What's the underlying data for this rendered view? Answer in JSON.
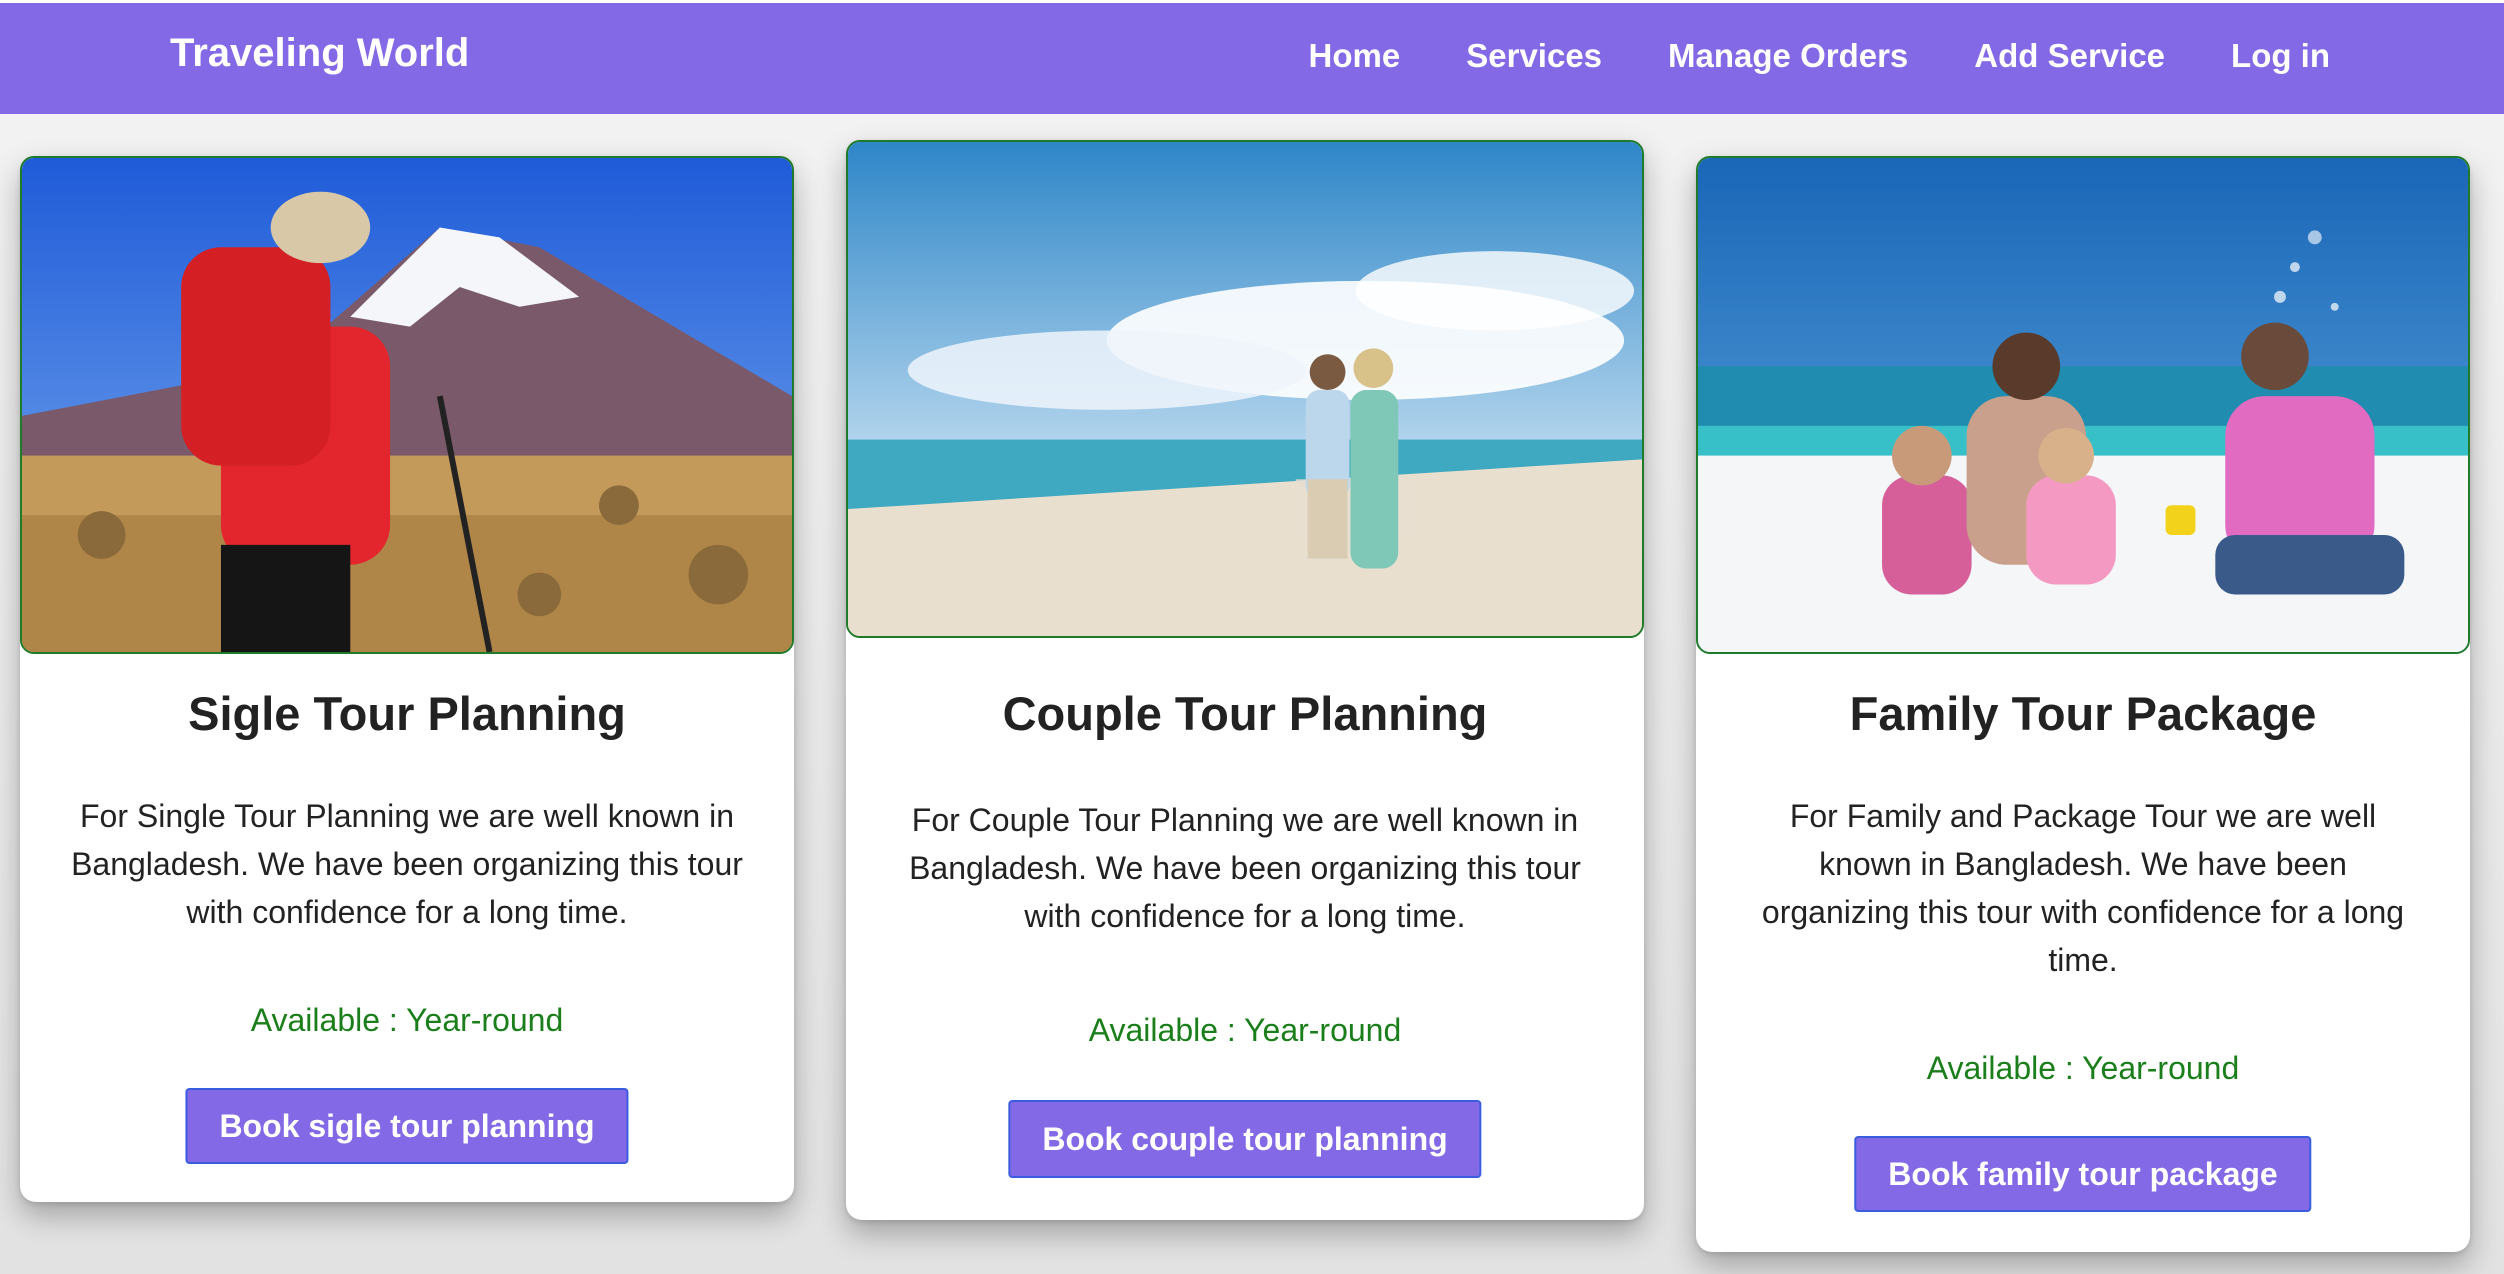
{
  "navbar": {
    "brand": "Traveling World",
    "links": [
      "Home",
      "Services",
      "Manage Orders",
      "Add Service",
      "Log in"
    ]
  },
  "cards": [
    {
      "image": "hiker-mountain-image",
      "title": "Sigle Tour Planning",
      "text_lines": [
        "For Single Tour Planning we are well known in",
        "Bangladesh. We have been organizing this tour",
        "with confidence for a long time."
      ],
      "availability": "Available : Year-round",
      "button": "Book sigle tour planning"
    },
    {
      "image": "couple-beach-image",
      "title": "Couple Tour Planning",
      "text_lines": [
        "For Couple Tour Planning we are well known in",
        "Bangladesh. We have been organizing this tour",
        "with confidence for a long time."
      ],
      "availability": "Available : Year-round",
      "button": "Book couple tour planning"
    },
    {
      "image": "family-beach-image",
      "title": "Family Tour Package",
      "text_lines": [
        "For Family and Package Tour we are well",
        "known in Bangladesh. We have been",
        "organizing this tour with confidence for a long",
        "time."
      ],
      "availability": "Available : Year-round",
      "button": "Book family tour package"
    }
  ],
  "colors": {
    "navbar": "#8469e6",
    "button": "#8469e6",
    "button_border": "#3a5de0",
    "availability": "#1a7f1a",
    "image_border": "#1f7a2a"
  }
}
